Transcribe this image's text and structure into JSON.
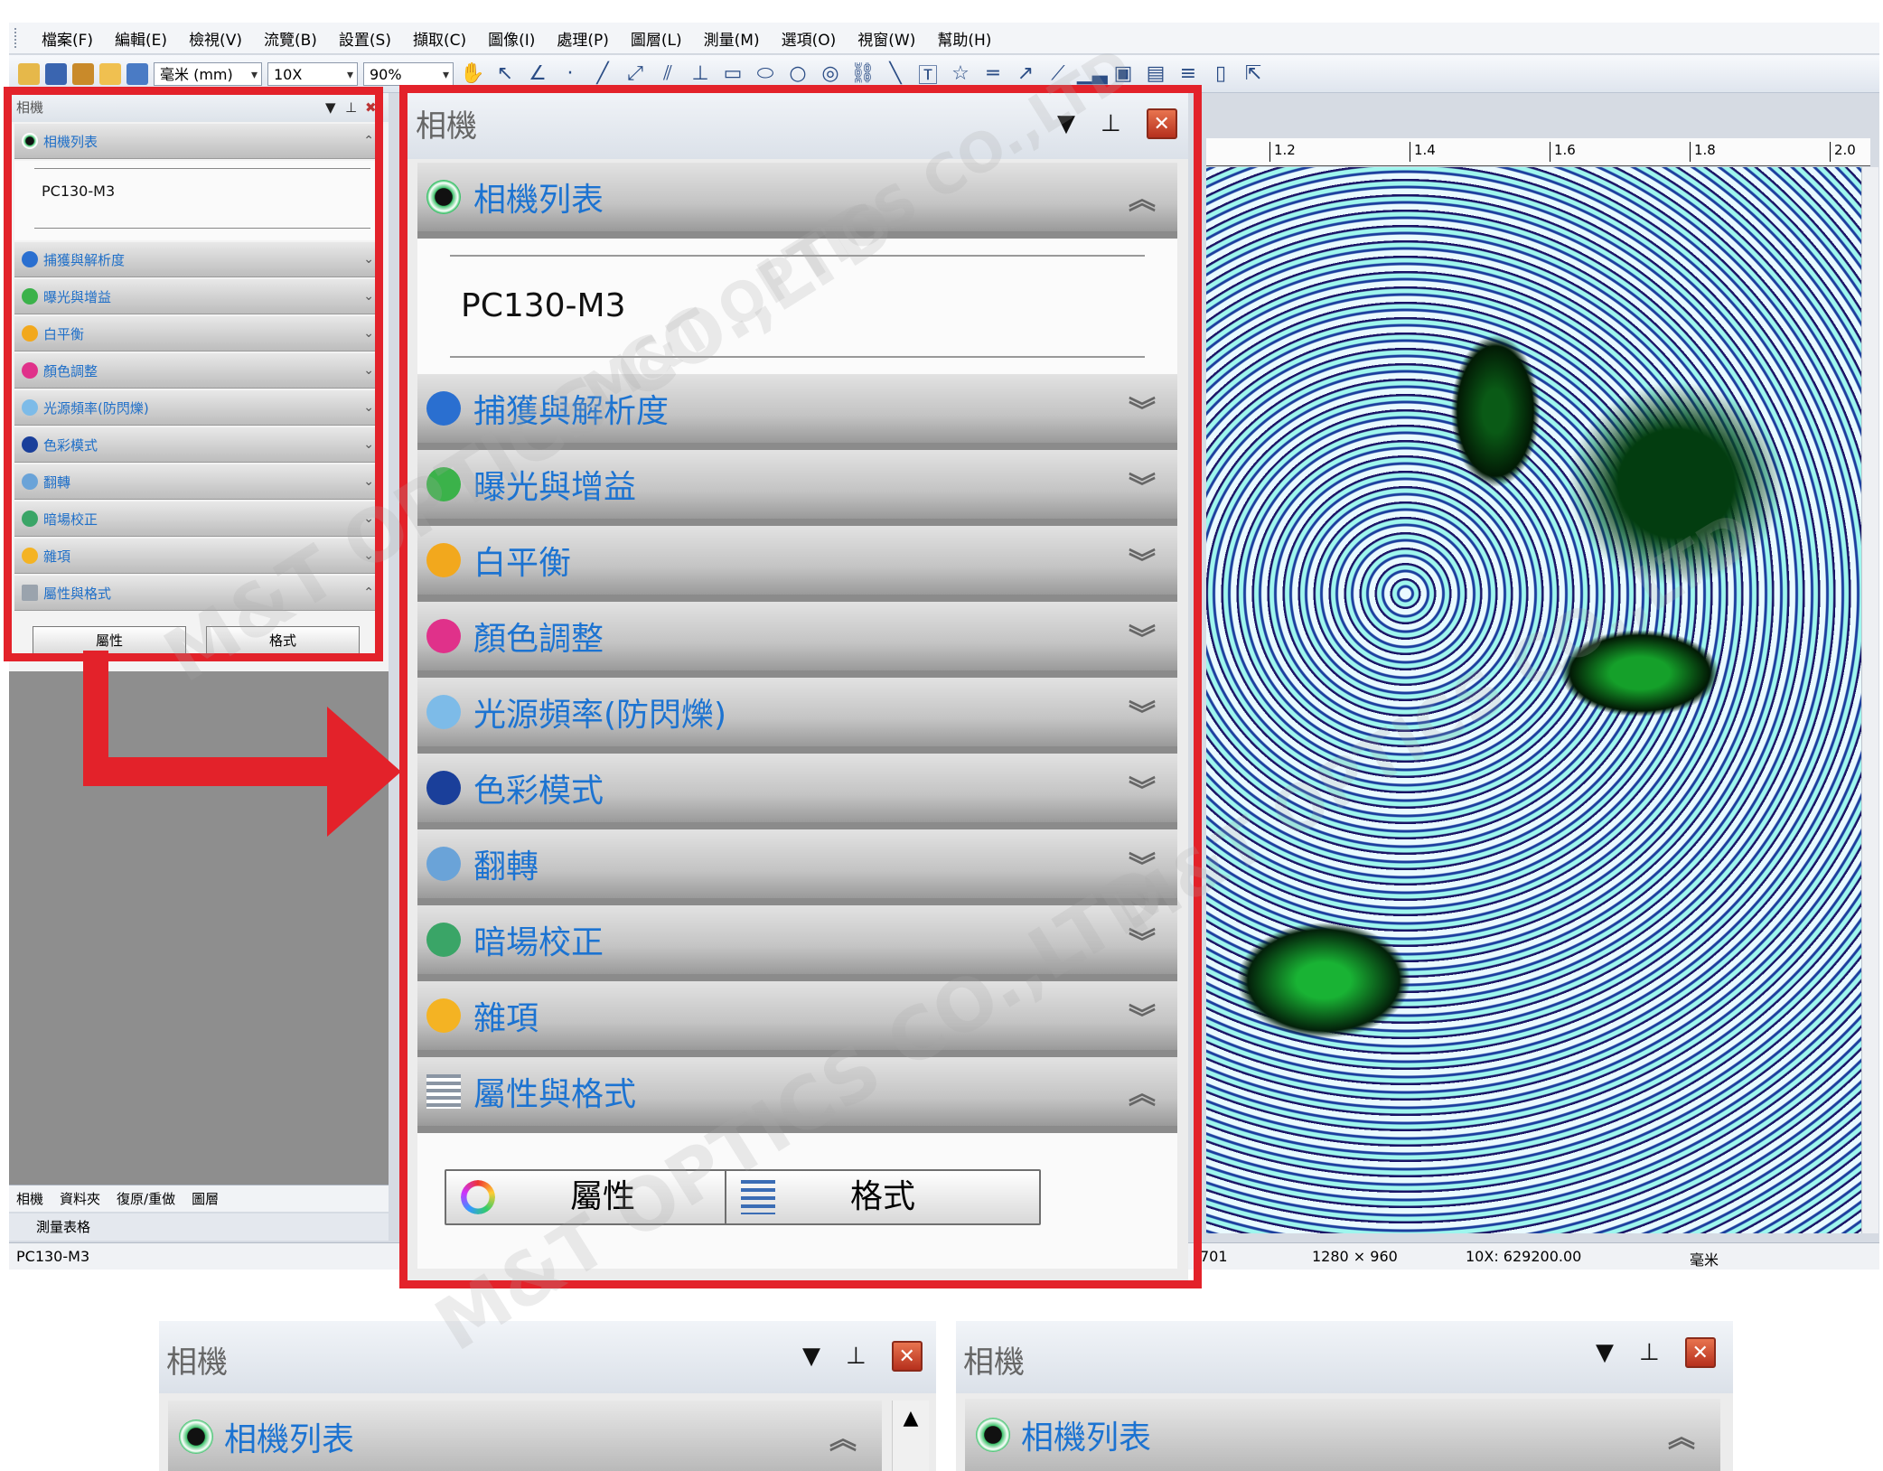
{
  "menu": [
    "檔案(F)",
    "編輯(E)",
    "檢視(V)",
    "流覽(B)",
    "設置(S)",
    "擷取(C)",
    "圖像(I)",
    "處理(P)",
    "圖層(L)",
    "測量(M)",
    "選項(O)",
    "視窗(W)",
    "幫助(H)"
  ],
  "toolbar": {
    "unit": "毫米 (mm)",
    "magnification": "10X",
    "zoom": "90%"
  },
  "panel": {
    "title": "相機",
    "camera_list_header": "相機列表",
    "camera_selected": "PC130-M3",
    "sections": [
      {
        "label": "捕獲與解析度",
        "icon": "capture-resolution-icon",
        "color": "#2a6fd0"
      },
      {
        "label": "曝光與增益",
        "icon": "exposure-gain-icon",
        "color": "#3bb24a"
      },
      {
        "label": "白平衡",
        "icon": "white-balance-icon",
        "color": "#f2a81d"
      },
      {
        "label": "顏色調整",
        "icon": "color-adjust-icon",
        "color": "#e0318a"
      },
      {
        "label": "光源頻率(防閃爍)",
        "icon": "light-frequency-icon",
        "color": "#7dbbe8"
      },
      {
        "label": "色彩模式",
        "icon": "color-mode-icon",
        "color": "#1a3f9a"
      },
      {
        "label": "翻轉",
        "icon": "flip-icon",
        "color": "#6aa3d8"
      },
      {
        "label": "暗場校正",
        "icon": "dark-field-icon",
        "color": "#3aa567"
      },
      {
        "label": "雜項",
        "icon": "misc-icon",
        "color": "#f4b323"
      }
    ],
    "properties_header": "屬性與格式",
    "properties_button": "屬性",
    "format_button": "格式"
  },
  "dock_tabs": [
    "相機",
    "資料夾",
    "復原/重做",
    "圖層"
  ],
  "dock_tab2": "測量表格",
  "ruler": [
    "1.2",
    "1.4",
    "1.6",
    "1.8",
    "2.0"
  ],
  "status": {
    "camera": "PC130-M3",
    "coord": "701",
    "resolution": "1280 × 960",
    "calibration": "10X: 629200.00",
    "unit": "毫米"
  },
  "watermark": "M&T OPTICS CO.,LTD",
  "colors": {
    "accent_red": "#e3222a",
    "header_blue": "#1c73d1"
  }
}
